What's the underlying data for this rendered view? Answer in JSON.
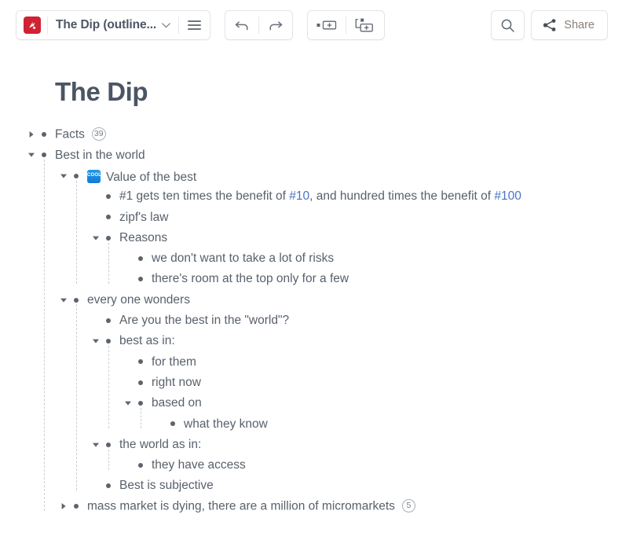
{
  "toolbar": {
    "logo_icon": "dynalist-logo-icon",
    "document_title": "The Dip (outline...",
    "chevron_icon": "chevron-down-icon",
    "menu_icon": "hamburger-menu-icon",
    "undo_icon": "undo-arrow-icon",
    "redo_icon": "redo-arrow-icon",
    "insert_sibling_icon": "insert-item-icon",
    "insert_child_icon": "insert-child-item-icon",
    "search_icon": "search-icon",
    "share_icon": "share-icon",
    "share_label": "Share"
  },
  "document": {
    "title": "The Dip"
  },
  "colors": {
    "logo_red": "#cf2233",
    "link_blue": "#4a73c7",
    "text_gray": "#58616c",
    "share_text": "#8a7f77",
    "thumb_blue": "#1579d8"
  },
  "outline": [
    {
      "id": "facts",
      "depth": 0,
      "text": "Facts",
      "state": "collapsed",
      "count": "39"
    },
    {
      "id": "best-in-the-world",
      "depth": 0,
      "text": "Best in the world",
      "state": "expanded"
    },
    {
      "id": "value-of-the-best",
      "depth": 1,
      "text": "Value of the best",
      "state": "expanded",
      "thumbnail": "cool-image-thumbnail",
      "thumbnail_label": "COOL"
    },
    {
      "id": "number-one-benefit",
      "depth": 2,
      "state": "leaf",
      "rich": [
        {
          "t": "#1 gets ten times the benefit of ",
          "link": false
        },
        {
          "t": "#10",
          "link": true
        },
        {
          "t": ", and hundred times the benefit of ",
          "link": false
        },
        {
          "t": "#100",
          "link": true
        }
      ]
    },
    {
      "id": "zipfs-law",
      "depth": 2,
      "text": "zipf's law",
      "state": "leaf"
    },
    {
      "id": "reasons",
      "depth": 2,
      "text": "Reasons",
      "state": "expanded"
    },
    {
      "id": "avoid-risks",
      "depth": 3,
      "text": "we don't want to take a lot of risks",
      "state": "leaf"
    },
    {
      "id": "room-at-the-top",
      "depth": 3,
      "text": "there's room at the top only for a few",
      "state": "leaf"
    },
    {
      "id": "every-one-wonders",
      "depth": 1,
      "text": "every one wonders",
      "state": "expanded"
    },
    {
      "id": "are-you-the-best",
      "depth": 2,
      "text": "Are you the best in the \"world\"?",
      "state": "leaf"
    },
    {
      "id": "best-as-in",
      "depth": 2,
      "text": "best as in:",
      "state": "expanded"
    },
    {
      "id": "for-them",
      "depth": 3,
      "text": "for them",
      "state": "leaf"
    },
    {
      "id": "right-now",
      "depth": 3,
      "text": "right now",
      "state": "leaf"
    },
    {
      "id": "based-on",
      "depth": 3,
      "text": "based on",
      "state": "expanded"
    },
    {
      "id": "what-they-know",
      "depth": 4,
      "text": "what they know",
      "state": "leaf"
    },
    {
      "id": "the-world-as-in",
      "depth": 2,
      "text": "the world as in:",
      "state": "expanded"
    },
    {
      "id": "they-have-access",
      "depth": 3,
      "text": "they have access",
      "state": "leaf"
    },
    {
      "id": "best-is-subjective",
      "depth": 2,
      "text": "Best is subjective",
      "state": "leaf"
    },
    {
      "id": "mass-market-dying",
      "depth": 1,
      "text": "mass market is dying, there are a million of micromarkets",
      "state": "collapsed",
      "count": "5"
    }
  ]
}
